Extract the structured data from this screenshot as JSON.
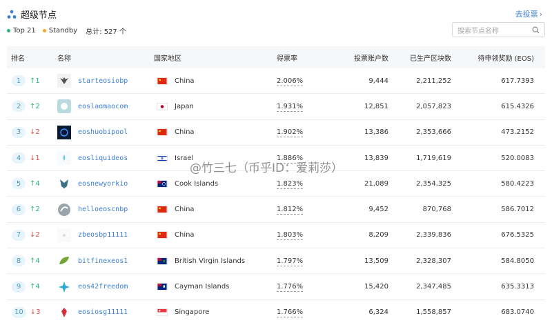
{
  "header": {
    "title": "超级节点",
    "vote_link": "去投票",
    "filter_top": "Top 21",
    "filter_standby": "Standby",
    "total": "总计: 527 个",
    "search_placeholder": "搜索节点名称",
    "colors": {
      "top_dot": "#2bb07f",
      "standby_dot": "#f5a623",
      "link": "#3d7fd0"
    }
  },
  "table": {
    "columns": [
      "排名",
      "名称",
      "国家地区",
      "得票率",
      "投票账户数",
      "已生产区块数",
      "待申领奖励 (EOS)"
    ],
    "rows": [
      {
        "rank": "1",
        "change": "1",
        "dir": "up",
        "name": "starteosiobp",
        "country": "China",
        "flag": "china-flag",
        "rate": "2.006%",
        "voters": "9,444",
        "blocks": "2,211,252",
        "reward": "617.7393",
        "logo_icon": "starteos-logo-icon"
      },
      {
        "rank": "2",
        "change": "2",
        "dir": "up",
        "name": "eoslaomaocom",
        "country": "Japan",
        "flag": "japan-flag",
        "rate": "1.931%",
        "voters": "12,851",
        "blocks": "2,057,823",
        "reward": "615.4326",
        "logo_icon": "eoslaomao-logo-icon"
      },
      {
        "rank": "3",
        "change": "2",
        "dir": "down",
        "name": "eoshuobipool",
        "country": "China",
        "flag": "china-flag",
        "rate": "1.902%",
        "voters": "13,386",
        "blocks": "2,353,666",
        "reward": "473.2152",
        "logo_icon": "huobipool-logo-icon"
      },
      {
        "rank": "4",
        "change": "1",
        "dir": "down",
        "name": "eosliquideos",
        "country": "Israel",
        "flag": "israel-flag",
        "rate": "1.886%",
        "voters": "13,839",
        "blocks": "1,719,619",
        "reward": "520.0083",
        "logo_icon": "liquideos-logo-icon"
      },
      {
        "rank": "5",
        "change": "4",
        "dir": "up",
        "name": "eosnewyorkio",
        "country": "Cook Islands",
        "flag": "cook-islands-flag",
        "rate": "1.823%",
        "voters": "21,089",
        "blocks": "2,354,325",
        "reward": "580.4223",
        "logo_icon": "eosnewyork-logo-icon"
      },
      {
        "rank": "6",
        "change": "2",
        "dir": "up",
        "name": "helloeoscnbp",
        "country": "China",
        "flag": "china-flag",
        "rate": "1.812%",
        "voters": "9,452",
        "blocks": "870,768",
        "reward": "586.7012",
        "logo_icon": "helloeos-logo-icon"
      },
      {
        "rank": "7",
        "change": "2",
        "dir": "down",
        "name": "zbeosbp11111",
        "country": "China",
        "flag": "china-flag",
        "rate": "1.803%",
        "voters": "8,209",
        "blocks": "2,339,836",
        "reward": "676.5325",
        "logo_icon": "zbeos-logo-icon"
      },
      {
        "rank": "8",
        "change": "4",
        "dir": "up",
        "name": "bitfinexeos1",
        "country": "British Virgin Islands",
        "flag": "bvi-flag",
        "rate": "1.797%",
        "voters": "13,509",
        "blocks": "2,328,307",
        "reward": "584.8050",
        "logo_icon": "bitfinex-logo-icon"
      },
      {
        "rank": "9",
        "change": "4",
        "dir": "up",
        "name": "eos42freedom",
        "country": "Cayman Islands",
        "flag": "cayman-flag",
        "rate": "1.776%",
        "voters": "15,420",
        "blocks": "2,347,485",
        "reward": "635.3313",
        "logo_icon": "eos42-logo-icon"
      },
      {
        "rank": "10",
        "change": "3",
        "dir": "down",
        "name": "eosiosg11111",
        "country": "Singapore",
        "flag": "singapore-flag",
        "rate": "1.766%",
        "voters": "6,324",
        "blocks": "1,558,857",
        "reward": "683.0740",
        "logo_icon": "eosiosg-logo-icon"
      }
    ]
  },
  "watermark": "@竹三七（币乎ID：爱莉莎）"
}
